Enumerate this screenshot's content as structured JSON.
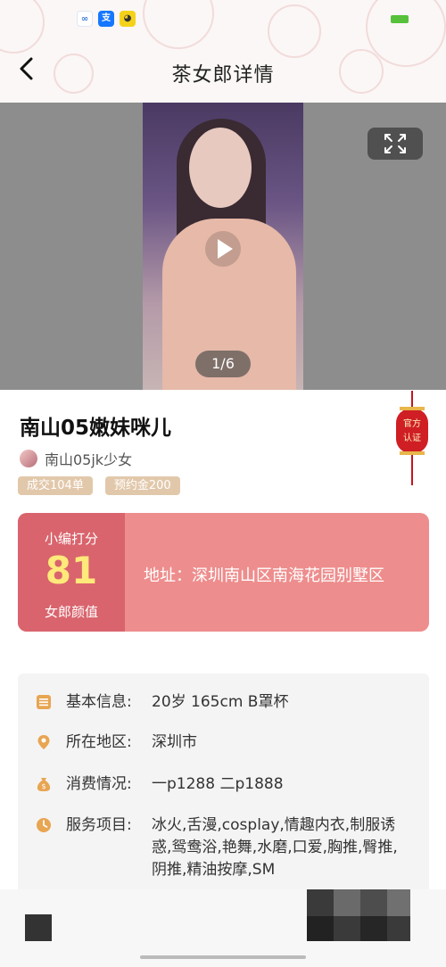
{
  "status_bar": {
    "icons": [
      "cloud-sync-icon",
      "alipay-icon",
      "app-icon"
    ]
  },
  "header": {
    "title": "茶女郎详情"
  },
  "media": {
    "counter": "1/6"
  },
  "profile": {
    "name": "南山05嫩妹咪儿",
    "username": "南山05jk少女",
    "tags": [
      "成交104单",
      "预约金200"
    ],
    "official_badge": "官方认证"
  },
  "score_card": {
    "top_label": "小编打分",
    "score": "81",
    "bottom_label": "女郎颜值",
    "address": "地址：深圳南山区南海花园别墅区"
  },
  "info": {
    "rows": [
      {
        "icon": "info-list-icon",
        "label": "基本信息:",
        "value": "20岁  165cm  B罩杯"
      },
      {
        "icon": "location-pin-icon",
        "label": "所在地区:",
        "value": "深圳市"
      },
      {
        "icon": "money-bag-icon",
        "label": "消费情况:",
        "value": "一p1288 二p1888"
      },
      {
        "icon": "clock-icon",
        "label": "服务项目:",
        "value": "冰火,舌漫,cosplay,情趣内衣,制服诱惑,鸳鸯浴,艳舞,水磨,口爱,胸推,臀推,阴推,精油按摩,SM"
      }
    ]
  },
  "colors": {
    "score_dark": "#d9646d",
    "score_light": "#ee8d8d",
    "score_number": "#ffe97a",
    "tag_bg": "#e2c8ab",
    "icon_orange": "#e8a552"
  }
}
